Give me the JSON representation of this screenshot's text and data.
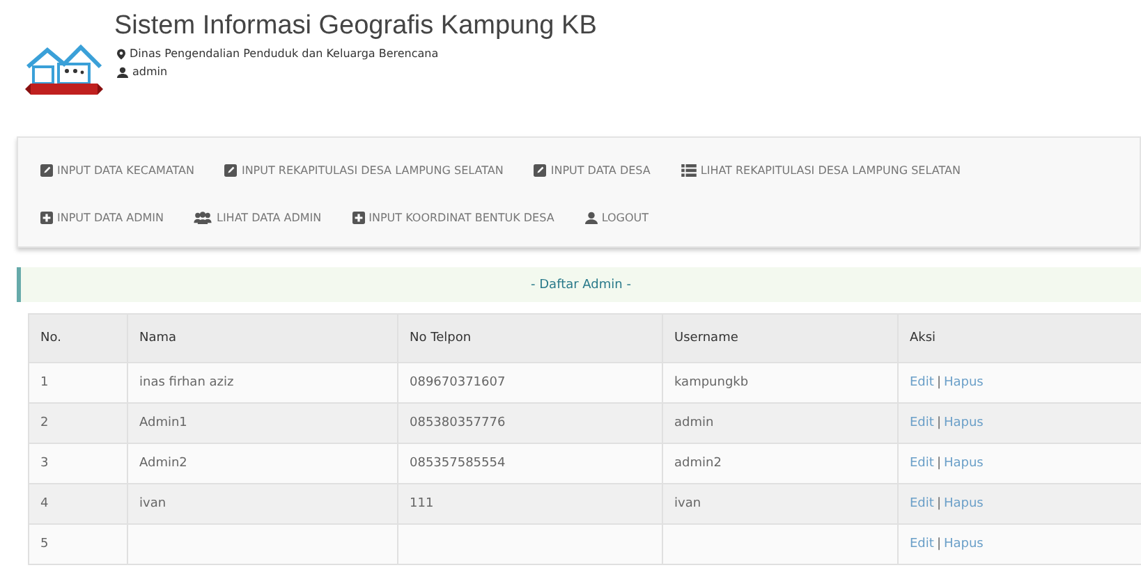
{
  "header": {
    "title": "Sistem Informasi Geografis Kampung KB",
    "agency": "Dinas Pengendalian Penduduk dan Keluarga Berencana",
    "user": "admin"
  },
  "nav": [
    [
      {
        "kind": "edit",
        "label": "INPUT DATA KECAMATAN"
      },
      {
        "kind": "edit",
        "label": "INPUT REKAPITULASI DESA LAMPUNG SELATAN"
      },
      {
        "kind": "edit",
        "label": "INPUT DATA DESA"
      },
      {
        "kind": "list",
        "label": "LIHAT REKAPITULASI DESA LAMPUNG SELATAN"
      }
    ],
    [
      {
        "kind": "add",
        "label": "INPUT DATA ADMIN"
      },
      {
        "kind": "group",
        "label": "LIHAT DATA ADMIN"
      },
      {
        "kind": "add",
        "label": "INPUT KOORDINAT BENTUK DESA"
      },
      {
        "kind": "account",
        "label": "LOGOUT"
      }
    ]
  ],
  "panel": {
    "title": "- Daftar Admin -"
  },
  "table": {
    "columns": [
      "No.",
      "Nama",
      "No Telpon",
      "Username",
      "Aksi"
    ],
    "rows": [
      {
        "no": "1",
        "nama": "inas firhan aziz",
        "telpon": "089670371607",
        "username": "kampungkb",
        "actions": [
          "Edit",
          "|",
          "Hapus"
        ]
      },
      {
        "no": "2",
        "nama": "Admin1",
        "telpon": "085380357776",
        "username": "admin",
        "actions": [
          "Edit",
          "|",
          "Hapus"
        ]
      },
      {
        "no": "3",
        "nama": "Admin2",
        "telpon": "085357585554",
        "username": "admin2",
        "actions": [
          "Edit",
          "|",
          "Hapus"
        ]
      },
      {
        "no": "4",
        "nama": "ivan",
        "telpon": "111",
        "username": "ivan",
        "actions": [
          "Edit",
          "|",
          "Hapus"
        ]
      },
      {
        "no": "5",
        "actions": [
          "Edit",
          "|",
          "Hapus"
        ]
      }
    ]
  }
}
